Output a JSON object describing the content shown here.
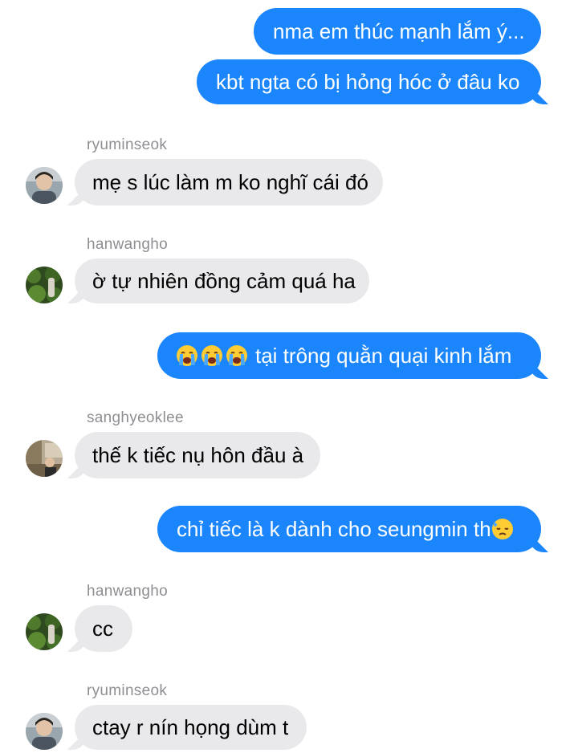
{
  "messages": [
    {
      "type": "outgoing",
      "text": "nma em thúc mạnh lắm ý..."
    },
    {
      "type": "outgoing",
      "text": "kbt ngta có bị hỏng hóc ở đâu ko"
    },
    {
      "type": "incoming",
      "sender": "ryuminseok",
      "text": "mẹ s lúc làm m ko nghĩ cái đó"
    },
    {
      "type": "incoming",
      "sender": "hanwangho",
      "text": "ờ tự nhiên đồng cảm quá ha"
    },
    {
      "type": "outgoing",
      "emojis": [
        "loudly-crying-face-emoji",
        "loudly-crying-face-emoji",
        "loudly-crying-face-emoji"
      ],
      "text": "tại trông quằn quại kinh lắm"
    },
    {
      "type": "incoming",
      "sender": "sanghyeoklee",
      "text": "thế k tiếc nụ hôn đầu à"
    },
    {
      "type": "outgoing",
      "text": "chỉ tiếc là k dành cho seungmin th",
      "emoji": "downcast-face-with-sweat-emoji"
    },
    {
      "type": "incoming",
      "sender": "hanwangho",
      "text": "cc"
    },
    {
      "type": "incoming",
      "sender": "ryuminseok",
      "text": "ctay r nín họng dùm t"
    }
  ],
  "colors": {
    "outgoing_bubble": "#1b86fb",
    "incoming_bubble": "#e9e9eb",
    "sender_name": "#8e8e93"
  }
}
